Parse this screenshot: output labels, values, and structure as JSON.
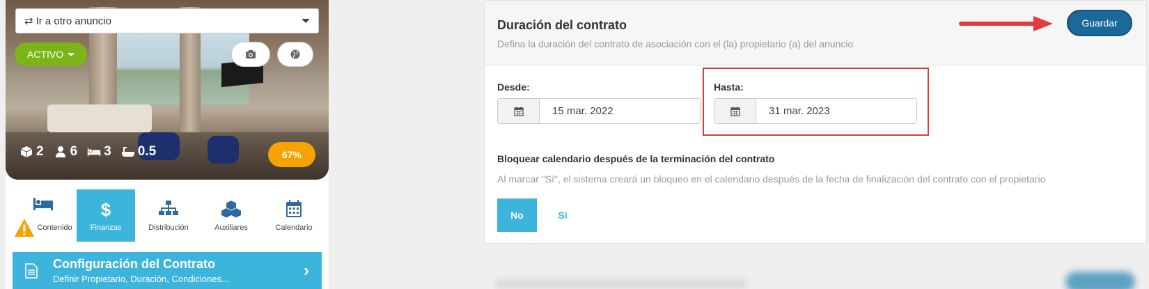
{
  "listing": {
    "goto_label": "Ir a otro anuncio",
    "status_label": "ACTIVO",
    "stats": {
      "rooms": "2",
      "guests": "6",
      "beds": "3",
      "baths": "0.5"
    },
    "completion": "67%"
  },
  "tabs": [
    {
      "label": "Contenido",
      "icon": "bed-icon",
      "warning": true
    },
    {
      "label": "Finanzas",
      "icon": "dollar-icon",
      "active": true
    },
    {
      "label": "Distribución",
      "icon": "sitemap-icon"
    },
    {
      "label": "Auxiliares",
      "icon": "cubes-icon"
    },
    {
      "label": "Calendario",
      "icon": "calendar-icon"
    }
  ],
  "config": {
    "title": "Configuración del Contrato",
    "subtitle": "Definir Propietario, Duración, Condiciones..."
  },
  "card": {
    "title": "Duración del contrato",
    "subtitle": "Defina la duración del contrato de asociación con el (la) propietario (a) del anuncio",
    "save_label": "Guardar",
    "from_label": "Desde:",
    "from_value": "15 mar. 2022",
    "to_label": "Hasta:",
    "to_value": "31 mar. 2023",
    "lock_title": "Bloquear calendario después de la terminación del contrato",
    "lock_desc": "Al marcar \"Sí\", el sistema creará un bloqueo en el calendario después de la fecha de finalización del contrato con el propietario",
    "no_label": "No",
    "yes_label": "Sí"
  },
  "colors": {
    "accent": "#3db4dc",
    "save": "#1a6a99",
    "status": "#7cb518",
    "completion": "#f5a300",
    "highlight": "#d93a3a"
  }
}
